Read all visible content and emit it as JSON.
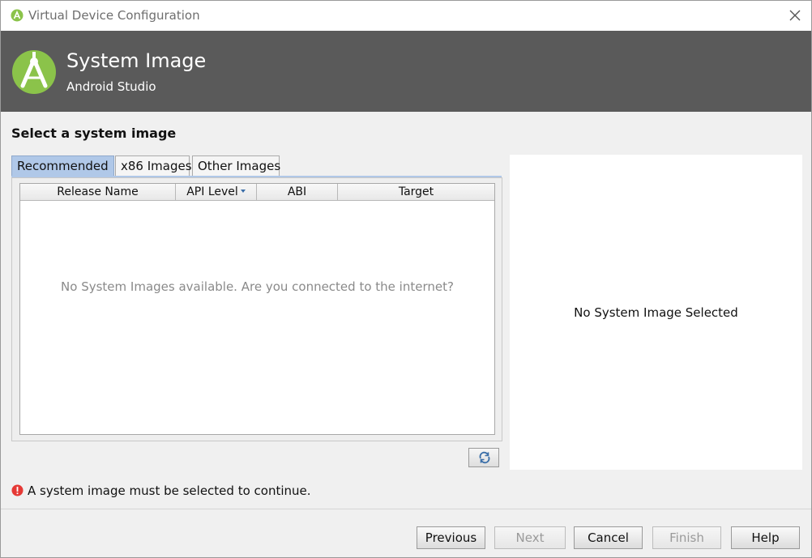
{
  "window": {
    "title": "Virtual Device Configuration"
  },
  "banner": {
    "title": "System Image",
    "subtitle": "Android Studio"
  },
  "section_title": "Select a system image",
  "tabs": [
    {
      "label": "Recommended",
      "active": true
    },
    {
      "label": "x86 Images",
      "active": false
    },
    {
      "label": "Other Images",
      "active": false
    }
  ],
  "table": {
    "columns": [
      "Release Name",
      "API Level",
      "ABI",
      "Target"
    ],
    "sorted_column": "API Level",
    "empty_message": "No System Images available. Are you connected to the internet?"
  },
  "details": {
    "message": "No System Image Selected"
  },
  "error": {
    "message": "A system image must be selected to continue."
  },
  "buttons": {
    "previous": "Previous",
    "next": "Next",
    "cancel": "Cancel",
    "finish": "Finish",
    "help": "Help"
  },
  "colors": {
    "banner_bg": "#5a5a5a",
    "tab_active": "#b0c8e8",
    "android_green": "#8bc34a",
    "error_red": "#e53935"
  }
}
